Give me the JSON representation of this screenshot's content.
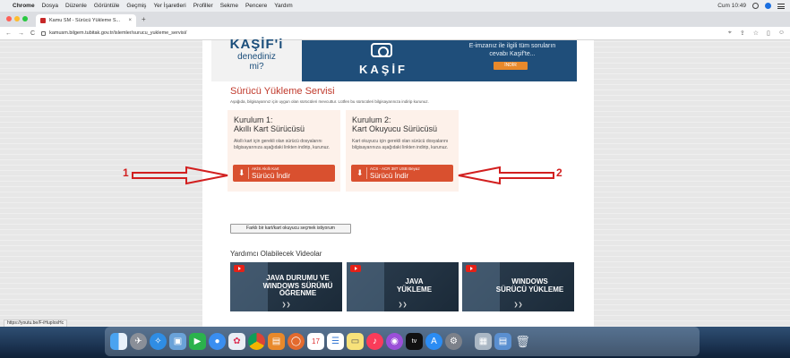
{
  "menubar": {
    "apple_glyph": "",
    "items": [
      "Chrome",
      "Dosya",
      "Düzenle",
      "Görüntüle",
      "Geçmiş",
      "Yer İşaretleri",
      "Profiller",
      "Sekme",
      "Pencere",
      "Yardım"
    ],
    "clock": "Cum 10:49"
  },
  "browser": {
    "tab_title": "Kamu SM - Sürücü Yükleme S...",
    "tab_close": "×",
    "new_tab": "+",
    "url": "kamusm.bilgem.tubitak.gov.tr/islemler/surucu_yukleme_servisi/",
    "nav_back": "←",
    "nav_forward": "→",
    "nav_reload": "C"
  },
  "banner": {
    "left_title": "KAŞİF'i",
    "left_line2": "denediniz",
    "left_line3": "mi?",
    "logo_text": "KAŞİF",
    "promo_text": "E-imzanız ile ilgili tüm soruların cevabı Kaşif'te...",
    "download_label": "İNDİR"
  },
  "service": {
    "title": "Sürücü Yükleme Servisi",
    "description": "Aşağıda, bilgisayarınız için uygun olan sürücüleri mevcuttur. Lütfen bu sürücüleri bilgisayarınıza indirip kurunuz."
  },
  "cards": [
    {
      "head_line1": "Kurulum 1:",
      "head_line2": "Akıllı Kart Sürücüsü",
      "text": "Akıllı kart için gerekli olan sürücü dosyalarını bilgisayarınıza aşağıdaki linkten indirip, kurunuz.",
      "button_small": "AKİS Akıllı Kart",
      "button_big": "Sürücü İndir"
    },
    {
      "head_line1": "Kurulum 2:",
      "head_line2": "Kart Okuyucu Sürücüsü",
      "text": "Kart okuyucu için gerekli olan sürücü dosyalarını bilgisayarınıza aşağıdaki linkten indirip, kurunuz.",
      "button_small": "ACS - ACR 38T USB Beyaz",
      "button_big": "Sürücü İndir"
    }
  ],
  "alt_button": "Farklı bir kart/kart okuyucu seçmek istiyorum",
  "videos": {
    "title": "Yardımcı Olabilecek Videolar",
    "items": [
      {
        "line1": "JAVA DURUMU VE",
        "line2": "WINDOWS SÜRÜMÜ",
        "line3": "ÖĞRENME"
      },
      {
        "line1": "JAVA",
        "line2": "YÜKLEME",
        "line3": ""
      },
      {
        "line1": "WINDOWS",
        "line2": "SÜRÜCÜ YÜKLEME",
        "line3": ""
      }
    ]
  },
  "annotations": {
    "left_label": "1",
    "right_label": "2",
    "color": "#d21f1f"
  },
  "status_url": "https://youtu.be/F-iHuplosHc",
  "colors": {
    "accent_red": "#d9502f",
    "title_red": "#c0392b",
    "banner_blue": "#1f4e7a",
    "card_bg": "#fdf1ea"
  },
  "dock": [
    "finder-icon",
    "launchpad-icon",
    "safari-icon",
    "preview-icon",
    "facetime-icon",
    "messages-icon",
    "photos-icon",
    "chrome-icon",
    "books-icon",
    "cortana-icon",
    "calendar-icon",
    "reminders-icon",
    "notes-icon",
    "music-icon",
    "podcasts-icon",
    "appletv-icon",
    "appstore-icon",
    "system-preferences-icon",
    "screenshot-folder-icon",
    "downloads-icon",
    "trash-icon"
  ]
}
